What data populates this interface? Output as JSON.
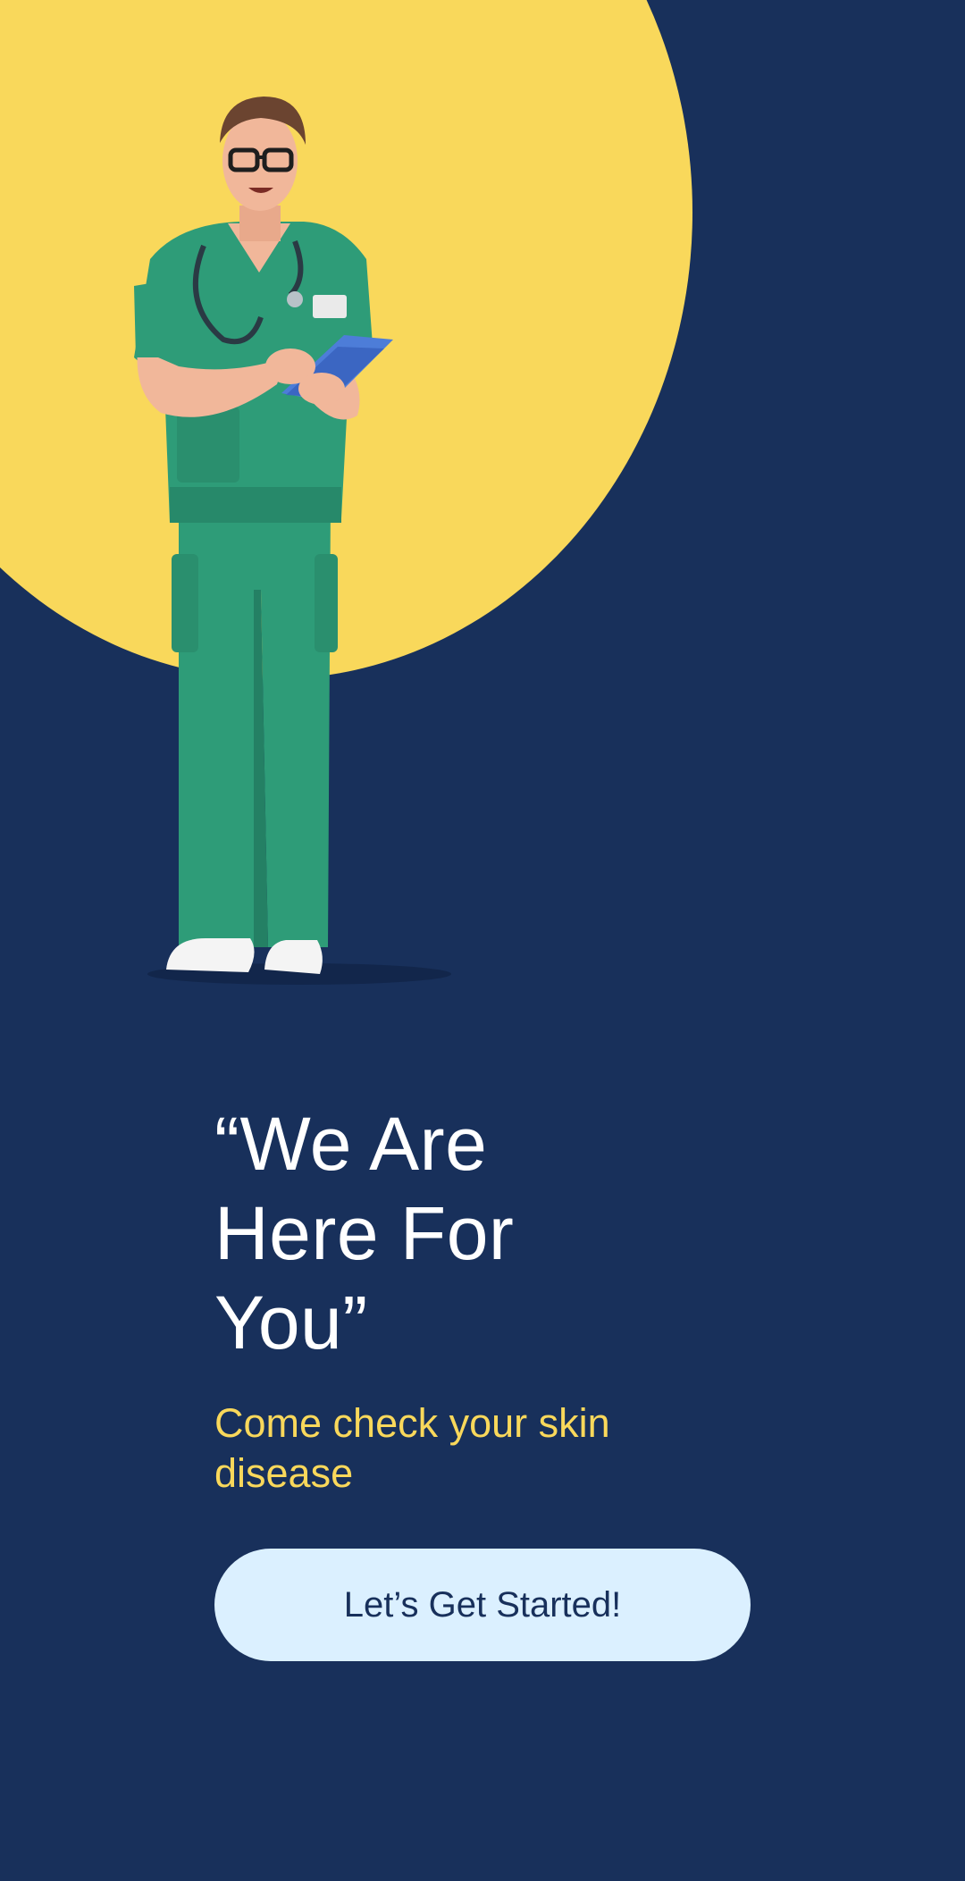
{
  "hero": {
    "illustration": "doctor-with-clipboard-illustration",
    "background_color": "#18305b",
    "circle_color": "#f9d85b"
  },
  "headline": {
    "line1": "“We Are",
    "line2": "Here For",
    "line3": "You”"
  },
  "subtitle": "Come check your skin disease",
  "cta": {
    "label": "Let’s Get Started!",
    "background": "#dbf0ff"
  }
}
